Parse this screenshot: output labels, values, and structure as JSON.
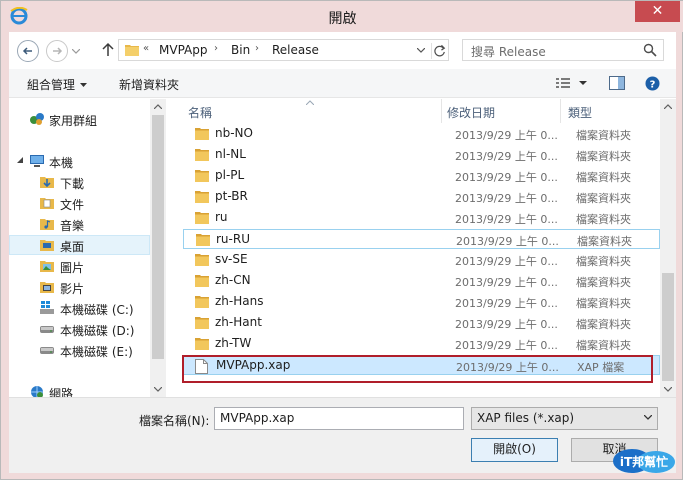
{
  "window": {
    "title": "開啟",
    "close_glyph": "✕"
  },
  "address": {
    "overflow": "«",
    "crumbs": [
      "MVPApp",
      "Bin",
      "Release"
    ],
    "sep": "›"
  },
  "search": {
    "placeholder": "搜尋 Release"
  },
  "toolbar": {
    "organize": "組合管理",
    "new_folder": "新增資料夾"
  },
  "navpane": {
    "items": [
      {
        "label": "家用群組",
        "icon": "homegroup-icon"
      },
      {
        "label": "本機",
        "icon": "computer-icon"
      },
      {
        "label": "下載",
        "icon": "downloads-folder-icon"
      },
      {
        "label": "文件",
        "icon": "documents-folder-icon"
      },
      {
        "label": "音樂",
        "icon": "music-folder-icon"
      },
      {
        "label": "桌面",
        "icon": "desktop-folder-icon"
      },
      {
        "label": "圖片",
        "icon": "pictures-folder-icon"
      },
      {
        "label": "影片",
        "icon": "videos-folder-icon"
      },
      {
        "label": "本機磁碟 (C:)",
        "icon": "system-drive-icon"
      },
      {
        "label": "本機磁碟 (D:)",
        "icon": "drive-icon"
      },
      {
        "label": "本機磁碟 (E:)",
        "icon": "drive-icon"
      },
      {
        "label": "網路",
        "icon": "network-icon"
      }
    ]
  },
  "columns": {
    "name": "名稱",
    "date": "修改日期",
    "type": "類型"
  },
  "files": [
    {
      "name": "nb-NO",
      "date": "2013/9/29 上午 0...",
      "type": "檔案資料夾"
    },
    {
      "name": "nl-NL",
      "date": "2013/9/29 上午 0...",
      "type": "檔案資料夾"
    },
    {
      "name": "pl-PL",
      "date": "2013/9/29 上午 0...",
      "type": "檔案資料夾"
    },
    {
      "name": "pt-BR",
      "date": "2013/9/29 上午 0...",
      "type": "檔案資料夾"
    },
    {
      "name": "ru",
      "date": "2013/9/29 上午 0...",
      "type": "檔案資料夾"
    },
    {
      "name": "ru-RU",
      "date": "2013/9/29 上午 0...",
      "type": "檔案資料夾"
    },
    {
      "name": "sv-SE",
      "date": "2013/9/29 上午 0...",
      "type": "檔案資料夾"
    },
    {
      "name": "zh-CN",
      "date": "2013/9/29 上午 0...",
      "type": "檔案資料夾"
    },
    {
      "name": "zh-Hans",
      "date": "2013/9/29 上午 0...",
      "type": "檔案資料夾"
    },
    {
      "name": "zh-Hant",
      "date": "2013/9/29 上午 0...",
      "type": "檔案資料夾"
    },
    {
      "name": "zh-TW",
      "date": "2013/9/29 上午 0...",
      "type": "檔案資料夾"
    },
    {
      "name": "MVPApp.xap",
      "date": "2013/9/29 上午 0...",
      "type": "XAP 檔案"
    }
  ],
  "bottom": {
    "filename_label": "檔案名稱(N):",
    "filename_value": "MVPApp.xap",
    "filetype_value": "XAP files (*.xap)",
    "open_label": "開啟(O)",
    "cancel_label": "取消"
  },
  "watermark": {
    "text": "iT邦幫忙"
  },
  "colors": {
    "accent": "#3c7fb1",
    "close": "#c74b50",
    "highlight": "#b01e2a",
    "selection": "#cce8ff"
  }
}
